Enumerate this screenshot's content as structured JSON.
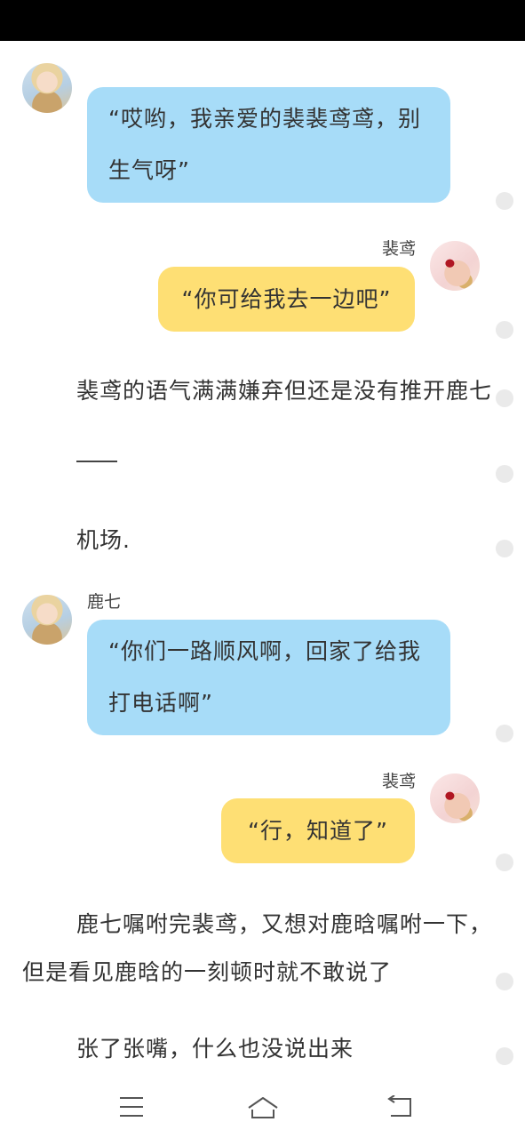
{
  "messages": [
    {
      "sender": "",
      "text_line1": "“哎哟，我亲爱的裴裴鸢鸢，别",
      "text_line2": "生气呀”"
    },
    {
      "sender": "裴鸢",
      "text": "“你可给我去一边吧”"
    },
    {
      "sender": "鹿七",
      "text_line1": "“你们一路顺风啊，回家了给我",
      "text_line2": "打电话啊”"
    },
    {
      "sender": "裴鸢",
      "text": "“行，知道了”"
    }
  ],
  "narration": {
    "line1": "裴鸢的语气满满嫌弃但还是没有推开鹿七",
    "line2": "机场.",
    "line3a": "鹿七嘱咐完裴鸢，又想对鹿晗嘱咐一下，",
    "line3b": "但是看见鹿晗的一刻顿时就不敢说了",
    "line4": "张了张嘴，什么也没说出来"
  },
  "colors": {
    "status_bar": "#000000",
    "bubble_blue": "#a7dcf8",
    "bubble_yellow": "#fedf74",
    "dot": "#eaeaea"
  },
  "icons": [
    "menu-icon",
    "home-icon",
    "back-icon"
  ]
}
